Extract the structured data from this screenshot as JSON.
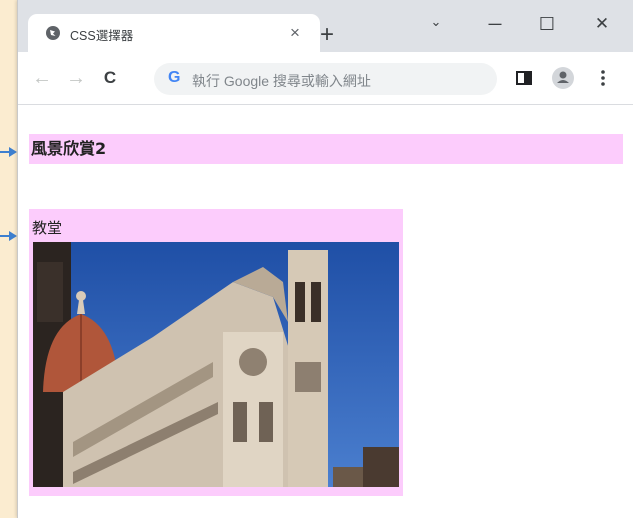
{
  "browser": {
    "tab_title": "CSS選擇器",
    "new_tab_symbol": "+",
    "tab_close_symbol": "×",
    "window_controls": {
      "dropdown": "⌄",
      "minimize": "—",
      "maximize": "☐",
      "close": "✕"
    },
    "nav": {
      "back": "←",
      "forward": "→",
      "reload": "C"
    },
    "address_bar": {
      "google_icon_letter": "G",
      "placeholder": "執行 Google 搜尋或輸入網址"
    }
  },
  "page": {
    "heading": "風景欣賞2",
    "card": {
      "label": "教堂",
      "image": "cathedral-photo"
    }
  },
  "colors": {
    "highlight": "#fcccfc",
    "margin_background": "#fbecd0",
    "arrow": "#3d7fcf",
    "tabstrip": "#dee1e6"
  }
}
